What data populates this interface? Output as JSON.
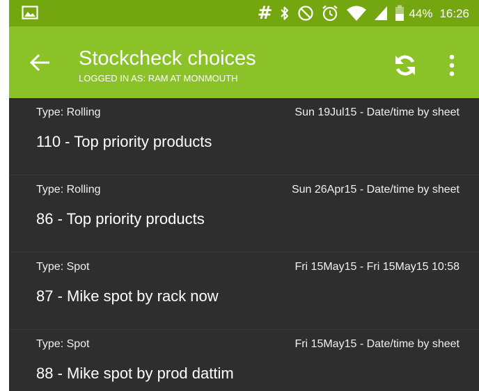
{
  "status_bar": {
    "left_icon": "image-icon",
    "hash_glyph": "#",
    "icons": [
      "bluetooth-icon",
      "do-not-disturb-icon",
      "alarm-icon",
      "wifi-icon",
      "signal-icon",
      "battery-icon"
    ],
    "battery_percent": "44%",
    "time": "16:26"
  },
  "app_bar": {
    "title": "Stockcheck choices",
    "subtitle": "LOGGED IN AS: RAM AT MONMOUTH",
    "back_icon": "arrow-back-icon",
    "refresh_icon": "refresh-icon",
    "more_icon": "more-vert-icon"
  },
  "items": [
    {
      "type": "Type: Rolling",
      "date": "Sun 19Jul15 - Date/time by sheet",
      "title": "110 - Top priority products"
    },
    {
      "type": "Type: Rolling",
      "date": "Sun 26Apr15 - Date/time by sheet",
      "title": "86 - Top priority products"
    },
    {
      "type": "Type: Spot",
      "date": "Fri 15May15 - Fri 15May15 10:58",
      "title": "87 - Mike spot by rack now"
    },
    {
      "type": "Type: Spot",
      "date": "Fri 15May15 - Date/time by sheet",
      "title": "88 - Mike spot by prod dattim"
    }
  ],
  "colors": {
    "status_bar": "#73a60f",
    "app_bar": "#8bc227",
    "list_background": "#2e2e2e",
    "text": "#ffffff"
  }
}
